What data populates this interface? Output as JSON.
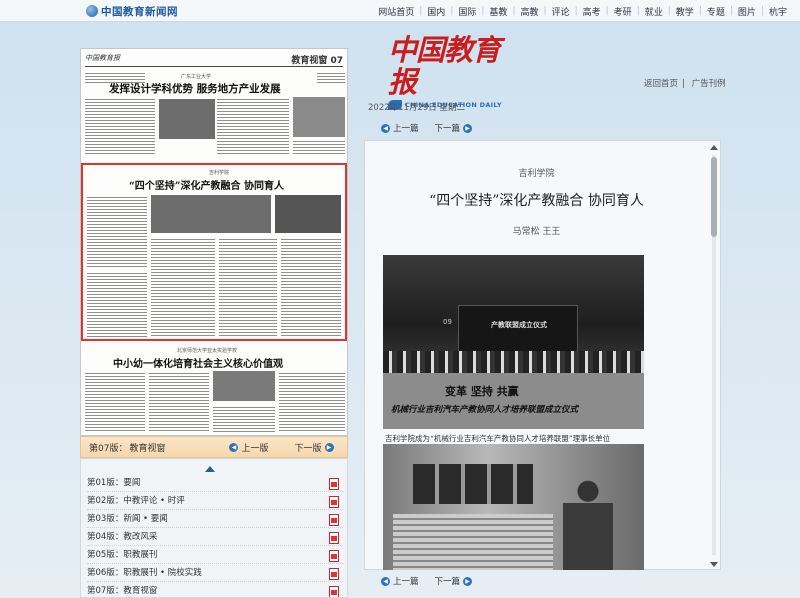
{
  "site": {
    "name": "中国教育新闻网",
    "nav": [
      "网站首页",
      "国内",
      "国际",
      "基教",
      "高教",
      "评论",
      "高考",
      "考研",
      "就业",
      "教学",
      "专题",
      "图片",
      "杭宇"
    ]
  },
  "masthead": {
    "title": "中国教育报",
    "subtitle": "CHINA EDUCATION DAILY"
  },
  "header_links": {
    "home": "返回首页",
    "ad": "广告刊例"
  },
  "date": "2022年11月29日 星期二",
  "article_pager": {
    "prev": "上一篇",
    "next": "下一篇"
  },
  "newspaper_page": {
    "masthead_small": "中国教育报",
    "section_tag": "教育视窗",
    "page_no": "07",
    "story1_school": "广东工业大学",
    "story1_title": "发挥设计学科优势 服务地方产业发展",
    "story2_school": "吉利学院",
    "story2_title": "“四个坚持”深化产教融合 协同育人",
    "story3_school": "北京师范大学亚太实验学校",
    "story3_title": "中小幼一体化培育社会主义核心价值观"
  },
  "edition_bar": {
    "label": "第07版：",
    "name": "教育视窗",
    "prev": "上一版",
    "next": "下一版"
  },
  "editions": [
    {
      "no": "第01版：",
      "name": "要闻"
    },
    {
      "no": "第02版：",
      "name": "中教评论 • 时评"
    },
    {
      "no": "第03版：",
      "name": "新闻 • 要闻"
    },
    {
      "no": "第04版：",
      "name": "教改风采"
    },
    {
      "no": "第05版：",
      "name": "职教展刊"
    },
    {
      "no": "第06版：",
      "name": "职教展刊 • 院校实践"
    },
    {
      "no": "第07版：",
      "name": "教育视窗"
    }
  ],
  "article": {
    "school": "吉利学院",
    "title": "“四个坚持”深化产教融合  协同育人",
    "authors": "马常松   王王",
    "photo1": {
      "screen_text": "产教联盟成立仪式",
      "screen_no": "09",
      "banner_main": "变革  坚持  共赢",
      "banner_sub": "机械行业吉利汽车产教协同人才培养联盟成立仪式"
    },
    "caption1": "吉利学院成为“机械行业吉利汽车产教协同人才培养联盟”理事长单位"
  },
  "colors": {
    "masthead_red": "#c81e1e",
    "highlight_red": "#e3332f",
    "link_blue": "#2b73c1",
    "site_blue": "#1e5aa0"
  }
}
